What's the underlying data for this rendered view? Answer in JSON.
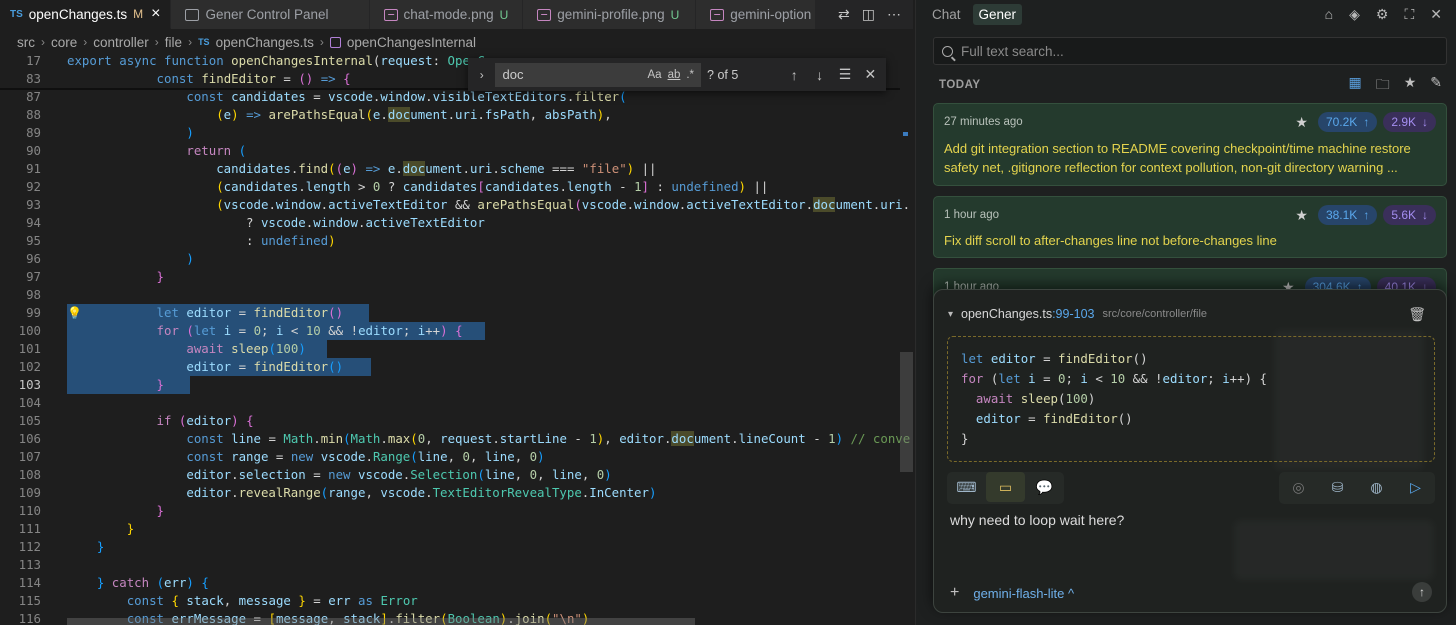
{
  "tabs": [
    {
      "lang": "TS",
      "label": "openChanges.ts",
      "badge": "M",
      "active": true
    },
    {
      "label": "Gener Control Panel"
    },
    {
      "label": "chat-mode.png",
      "badge": "U"
    },
    {
      "label": "gemini-profile.png",
      "badge": "U"
    },
    {
      "label": "gemini-option"
    }
  ],
  "breadcrumb": [
    "src",
    "core",
    "controller",
    "file",
    "openChanges.ts",
    "openChangesInternal"
  ],
  "find": {
    "query": "doc",
    "count": "? of 5",
    "case": "Aa",
    "word": "ab",
    "regex": ".*"
  },
  "gutter": {
    "l17": "17",
    "l83": "83",
    "l87": "87",
    "l88": "88",
    "l89": "89",
    "l90": "90",
    "l91": "91",
    "l92": "92",
    "l93": "93",
    "l94": "94",
    "l95": "95",
    "l96": "96",
    "l97": "97",
    "l98": "98",
    "l99": "99",
    "l100": "100",
    "l101": "101",
    "l102": "102",
    "l103": "103",
    "l104": "104",
    "l105": "105",
    "l106": "106",
    "l107": "107",
    "l108": "108",
    "l109": "109",
    "l110": "110",
    "l111": "111",
    "l112": "112",
    "l113": "113",
    "l114": "114",
    "l115": "115",
    "l116": "116"
  },
  "panel": {
    "tabs": [
      "Chat",
      "Gener"
    ],
    "search_placeholder": "Full text search...",
    "section": "TODAY",
    "cards": [
      {
        "time": "27 minutes ago",
        "up": "70.2K",
        "down": "2.9K",
        "message": "Add git integration section to README covering checkpoint/time machine restore safety net, .gitignore reflection for context pollution, non-git directory warning ..."
      },
      {
        "time": "1 hour ago",
        "up": "38.1K",
        "down": "5.6K",
        "message": "Fix diff scroll to after-changes line not before-changes line"
      },
      {
        "time": "1 hour ago",
        "up": "304.6K",
        "down": "40.1K",
        "message": ""
      }
    ],
    "context": {
      "file": "openChanges.ts",
      "range": ":99-103",
      "path": "src/core/controller/file"
    },
    "question": "why need to loop wait here?",
    "model": "gemini-flash-lite",
    "colors": {
      "accent_up": "#5aa8ec",
      "accent_down": "#a48ef0",
      "card_text": "#e4d44e",
      "selection": "#264f78"
    }
  }
}
